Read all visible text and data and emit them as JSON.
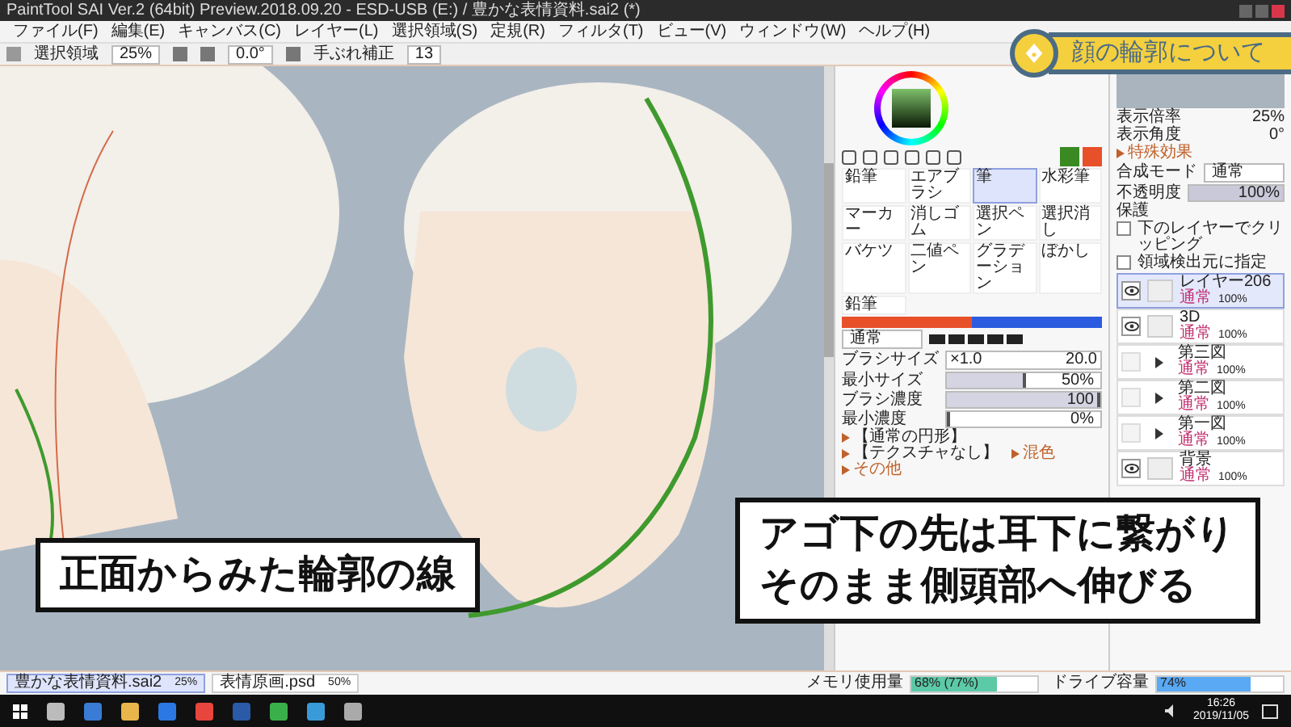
{
  "window": {
    "title": "PaintTool SAI Ver.2 (64bit) Preview.2018.09.20 - ESD-USB (E:) / 豊かな表情資料.sai2 (*)"
  },
  "menu": [
    "ファイル(F)",
    "編集(E)",
    "キャンバス(C)",
    "レイヤー(L)",
    "選択領域(S)",
    "定規(R)",
    "フィルタ(T)",
    "ビュー(V)",
    "ウィンドウ(W)",
    "ヘルプ(H)"
  ],
  "toolbar": {
    "selection_label": "選択領域",
    "zoom": "25%",
    "angle": "0.0°",
    "stabilizer_label": "手ぶれ補正",
    "stabilizer": "13"
  },
  "banner": {
    "text": "顔の輪郭について"
  },
  "captions": [
    {
      "lines": [
        "正面からみた輪郭の線"
      ]
    },
    {
      "lines": [
        "アゴ下の先は耳下に繋がり",
        "そのまま側頭部へ伸びる"
      ]
    }
  ],
  "colors": [
    {
      "color": "#3a8a24"
    },
    {
      "color": "#e8502a"
    }
  ],
  "tools": [
    {
      "label": "鉛筆",
      "selected": false
    },
    {
      "label": "エアブラシ",
      "selected": false
    },
    {
      "label": "筆",
      "selected": true
    },
    {
      "label": "水彩筆",
      "selected": false
    },
    {
      "label": "マーカー",
      "selected": false
    },
    {
      "label": "消しゴム",
      "selected": false
    },
    {
      "label": "選択ペン",
      "selected": false
    },
    {
      "label": "選択消し",
      "selected": false
    },
    {
      "label": "バケツ",
      "selected": false
    },
    {
      "label": "二値ペン",
      "selected": false
    },
    {
      "label": "グラデーション",
      "selected": false
    },
    {
      "label": "ぼかし",
      "selected": false
    },
    {
      "label": "鉛筆",
      "selected": false
    }
  ],
  "brush": {
    "mode": "通常",
    "params": [
      {
        "kind": "size",
        "label": "ブラシサイズ",
        "multiplier": "×1.0",
        "reading": "20.0"
      },
      {
        "kind": "slider",
        "label": "最小サイズ",
        "reading": "50%",
        "level": 0.5
      },
      {
        "kind": "slider",
        "label": "ブラシ濃度",
        "reading": "100",
        "level": 1
      },
      {
        "kind": "slider",
        "label": "最小濃度",
        "reading": "0%",
        "level": 0
      }
    ],
    "sections": [
      "【通常の円形】",
      "【テクスチャなし】",
      "混色",
      "その他"
    ]
  },
  "view": {
    "zoom_label": "表示倍率",
    "zoom": "25%",
    "angle_label": "表示角度",
    "angle": "0°"
  },
  "layer_props": {
    "effects": "特殊効果",
    "blend_label": "合成モード",
    "blend": "通常",
    "opacity_label": "不透明度",
    "opacity": {
      "reading": "100%",
      "level": 1
    },
    "protect_label": "保護",
    "options": [
      {
        "label": "下のレイヤーでクリッピング",
        "checked": false
      },
      {
        "label": "領域検出元に指定",
        "checked": false
      }
    ]
  },
  "layers": [
    {
      "kind": "layer",
      "name": "レイヤー206",
      "mode": "通常",
      "opacity": "100%",
      "visible": true,
      "selected": true
    },
    {
      "kind": "layer",
      "name": "3D",
      "mode": "通常",
      "opacity": "100%",
      "visible": true,
      "selected": false
    },
    {
      "kind": "folder",
      "name": "第三図",
      "mode": "通常",
      "opacity": "100%",
      "visible": false,
      "selected": false
    },
    {
      "kind": "folder",
      "name": "第二図",
      "mode": "通常",
      "opacity": "100%",
      "visible": false,
      "selected": false
    },
    {
      "kind": "folder",
      "name": "第一図",
      "mode": "通常",
      "opacity": "100%",
      "visible": false,
      "selected": false
    },
    {
      "kind": "layer",
      "name": "背景",
      "mode": "通常",
      "opacity": "100%",
      "visible": true,
      "selected": false
    }
  ],
  "documents": [
    {
      "name": "豊かな表情資料.sai2",
      "zoom": "25%",
      "selected": true
    },
    {
      "name": "表情原画.psd",
      "zoom": "50%",
      "selected": false
    }
  ],
  "status": [
    {
      "label": "メモリ使用量",
      "reading": "68% (77%)",
      "level": 0.68
    },
    {
      "label": "ドライブ容量",
      "reading": "74%",
      "level": 0.74
    }
  ],
  "clock": {
    "time": "16:26",
    "date": "2019/11/05"
  }
}
